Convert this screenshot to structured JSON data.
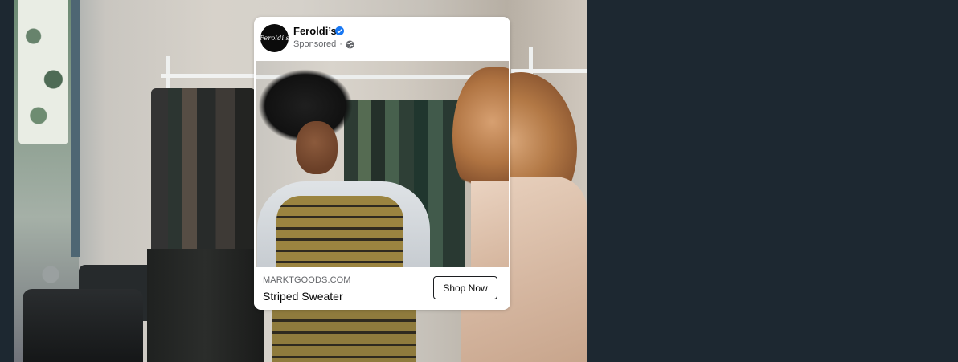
{
  "ad": {
    "advertiser": {
      "name": "Feroldi’s",
      "logo_text": "Feroldi's",
      "verified": true
    },
    "label": "Sponsored",
    "separator": "·",
    "audience_icon": "globe-icon",
    "link": {
      "domain": "MARKTGOODS.COM",
      "headline": "Striped Sweater"
    },
    "cta_label": "Shop Now"
  },
  "colors": {
    "page_background": "#1d2831",
    "verified_badge": "#1877f2",
    "card_background": "#ffffff",
    "secondary_text": "#65676b"
  }
}
